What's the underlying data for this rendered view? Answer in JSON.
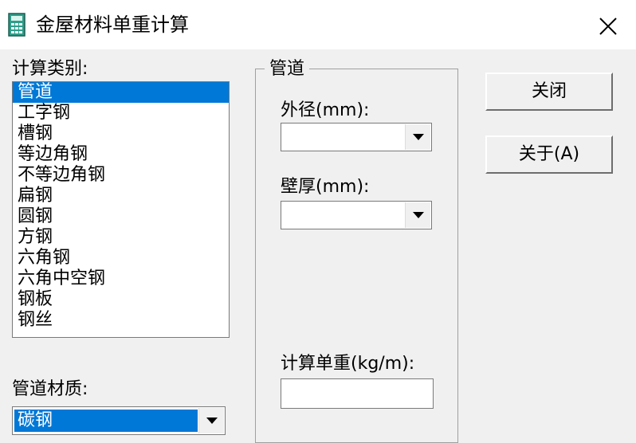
{
  "window": {
    "title": "金屋材料单重计算"
  },
  "category_list": {
    "label": "计算类别:",
    "selected_index": 0,
    "items": [
      "管道",
      "工字钢",
      "槽钢",
      "等边角钢",
      "不等边角钢",
      "扁钢",
      "圆钢",
      "方钢",
      "六角钢",
      "六角中空钢",
      "钢板",
      "钢丝"
    ]
  },
  "material": {
    "label": "管道材质:",
    "value": "碳钢"
  },
  "group": {
    "title": "管道",
    "outer_diameter_label": "外径(mm):",
    "outer_diameter_value": "",
    "wall_thickness_label": "壁厚(mm):",
    "wall_thickness_value": "",
    "unit_weight_label": "计算单重(kg/m):",
    "unit_weight_value": ""
  },
  "buttons": {
    "close_label": "关闭",
    "about_label": "关于(A)"
  },
  "colors": {
    "selection": "#0078d7",
    "icon": "#2e9e8a"
  },
  "icons": {
    "app": "calculator-icon",
    "close": "close-icon",
    "dropdown": "chevron-down-icon"
  }
}
